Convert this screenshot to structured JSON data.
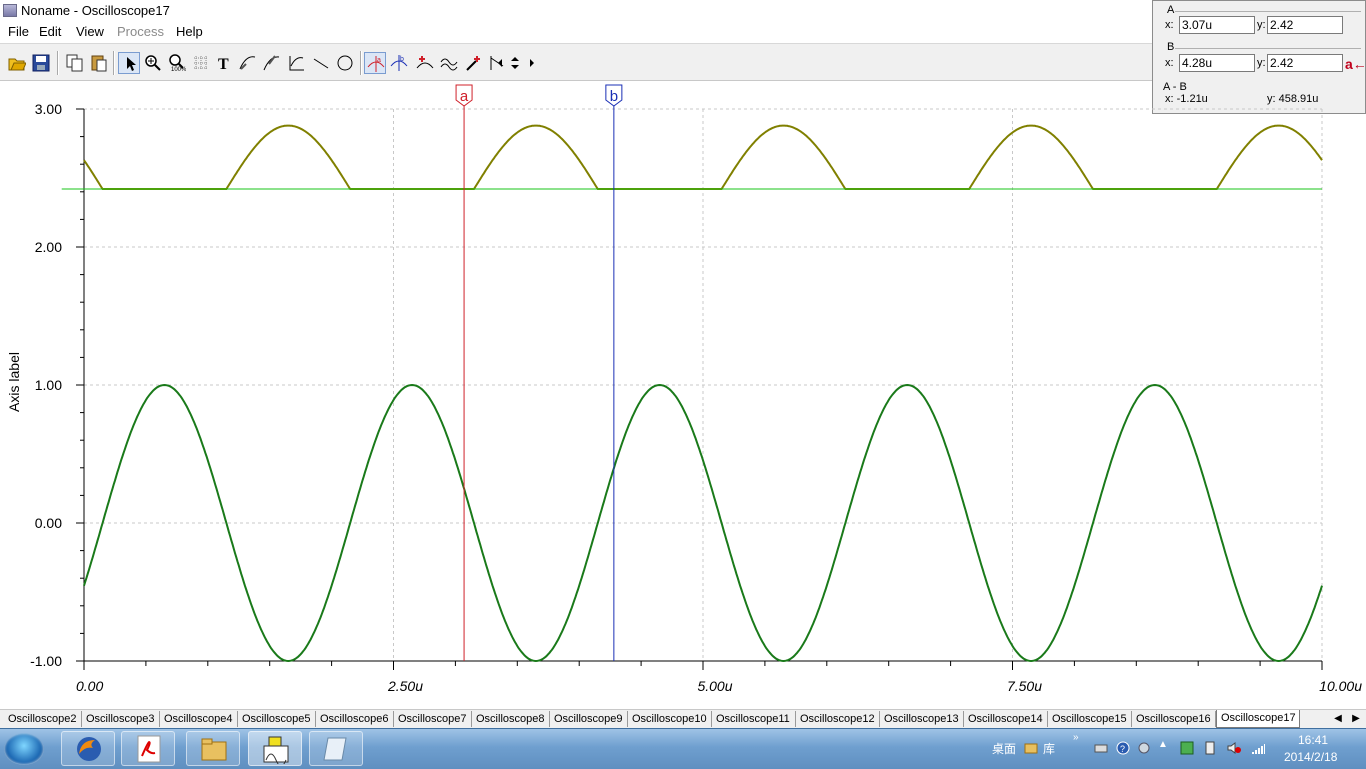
{
  "window": {
    "title": "Noname - Oscilloscope17"
  },
  "menu": {
    "items": [
      "File",
      "Edit",
      "View",
      "Process",
      "Help"
    ]
  },
  "toolbar": {
    "buttons": [
      "open-icon",
      "save-icon",
      "copy-icon",
      "paste-icon",
      "pointer-icon",
      "zoom-in-icon",
      "zoom-100-icon",
      "grid-icon",
      "text-icon",
      "curve-tool-icon",
      "curve-tool2-icon",
      "axis-tool-icon",
      "line-icon",
      "circle-icon",
      "cursor-a-icon",
      "cursor-b-icon",
      "add-marker-icon",
      "waveform-icon",
      "probe-icon",
      "slope-icon",
      "left-arrow-icon",
      "up-down-icon",
      "right-arrow-icon"
    ]
  },
  "cursor_panel": {
    "a": {
      "heading": "A",
      "x_label": "x:",
      "x_value": "3.07u",
      "y_label": "y:",
      "y_value": "2.42"
    },
    "b": {
      "heading": "B",
      "x_label": "x:",
      "x_value": "4.28u",
      "y_label": "y:",
      "y_value": "2.42",
      "swap_label": "a←"
    },
    "diff": {
      "heading": "A - B",
      "x_text": "x:  -1.21u",
      "y_text": "y: 458.91u"
    }
  },
  "chart_data": {
    "type": "line",
    "ylabel": "Axis label",
    "xlabel": "",
    "xlim": [
      0,
      10
    ],
    "ylim": [
      -1,
      3
    ],
    "x_unit": "u",
    "xticks": [
      "0.00",
      "2.50u",
      "5.00u",
      "7.50u",
      "10.00u"
    ],
    "xtick_values": [
      0,
      2.5,
      5,
      7.5,
      10
    ],
    "yticks": [
      "3.00",
      "2.00",
      "1.00",
      "0.00",
      "-1.00"
    ],
    "ytick_values": [
      3,
      2,
      1,
      0,
      -1
    ],
    "grid": true,
    "series": [
      {
        "color": "#808000",
        "description_points": "clipped half-wave: baseline 2.42, peaks 2.88",
        "x": [
          0,
          0.15,
          0.28,
          1.1,
          1.25,
          1.65,
          2.05,
          2.2,
          3.1,
          3.25,
          3.65,
          4.05,
          4.2,
          5.1,
          5.25,
          5.65,
          6.05,
          6.2,
          7.1,
          7.25,
          7.65,
          8.05,
          8.2,
          9.1,
          9.25,
          9.65,
          10.0
        ],
        "y": [
          2.71,
          2.55,
          2.42,
          2.42,
          2.62,
          2.88,
          2.62,
          2.42,
          2.42,
          2.62,
          2.88,
          2.62,
          2.42,
          2.42,
          2.62,
          2.88,
          2.62,
          2.42,
          2.42,
          2.62,
          2.88,
          2.62,
          2.42,
          2.42,
          2.62,
          2.88,
          2.72
        ]
      },
      {
        "color": "#1a7a1a",
        "sine": {
          "amplitude": 1.0,
          "offset": 0.0,
          "period": 2.0,
          "phase_x": 0.65
        }
      },
      {
        "color": "#19c419",
        "constant": 2.42
      }
    ],
    "cursors": [
      {
        "label": "a",
        "x": 3.07,
        "color": "#d0202a"
      },
      {
        "label": "b",
        "x": 4.28,
        "color": "#1a2fb5"
      }
    ]
  },
  "tabs": {
    "items": [
      "Oscilloscope2",
      "Oscilloscope3",
      "Oscilloscope4",
      "Oscilloscope5",
      "Oscilloscope6",
      "Oscilloscope7",
      "Oscilloscope8",
      "Oscilloscope9",
      "Oscilloscope10",
      "Oscilloscope11",
      "Oscilloscope12",
      "Oscilloscope13",
      "Oscilloscope14",
      "Oscilloscope15",
      "Oscilloscope16",
      "Oscilloscope17"
    ],
    "active": "Oscilloscope17"
  },
  "taskbar": {
    "desktop_label": "桌面",
    "library_label": "库",
    "time": "16:41",
    "date": "2014/2/18"
  }
}
